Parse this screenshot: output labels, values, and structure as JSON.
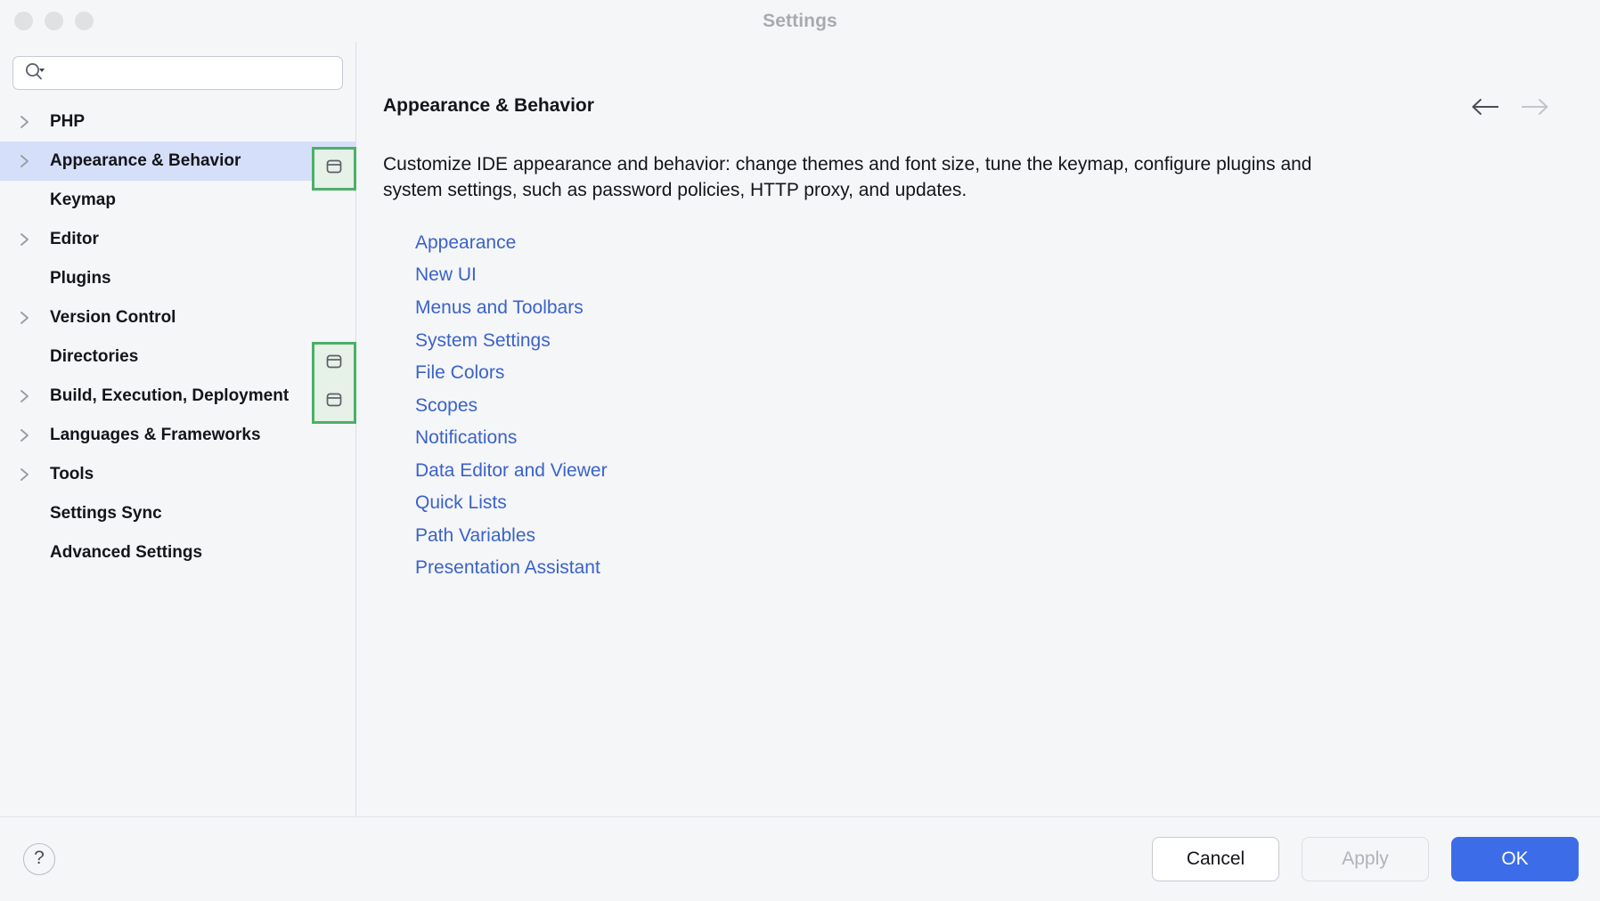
{
  "window": {
    "title": "Settings",
    "traffic_lights": [
      "close-button",
      "minimize-button",
      "maximize-button"
    ]
  },
  "search": {
    "value": "",
    "placeholder": "",
    "icon": "search-icon"
  },
  "sidebar": {
    "items": [
      {
        "label": "PHP",
        "expandable": true,
        "selected": false
      },
      {
        "label": "Appearance & Behavior",
        "expandable": true,
        "selected": true
      },
      {
        "label": "Keymap",
        "expandable": false,
        "selected": false
      },
      {
        "label": "Editor",
        "expandable": true,
        "selected": false
      },
      {
        "label": "Plugins",
        "expandable": false,
        "selected": false
      },
      {
        "label": "Version Control",
        "expandable": true,
        "selected": false
      },
      {
        "label": "Directories",
        "expandable": false,
        "selected": false
      },
      {
        "label": "Build, Execution, Deployment",
        "expandable": true,
        "selected": false
      },
      {
        "label": "Languages & Frameworks",
        "expandable": true,
        "selected": false
      },
      {
        "label": "Tools",
        "expandable": true,
        "selected": false
      },
      {
        "label": "Settings Sync",
        "expandable": false,
        "selected": false
      },
      {
        "label": "Advanced Settings",
        "expandable": false,
        "selected": false
      }
    ]
  },
  "annotations": {
    "border_color": "#4caf68",
    "fill_color": "#e6f1e8",
    "boxes": [
      {
        "name": "annotation-box-1",
        "icons": [
          "panel-icon"
        ]
      },
      {
        "name": "annotation-box-2",
        "icons": [
          "panel-icon",
          "panel-icon"
        ]
      }
    ]
  },
  "main": {
    "title": "Appearance & Behavior",
    "description": "Customize IDE appearance and behavior: change themes and font size, tune the keymap, configure plugins and system settings, such as password policies, HTTP proxy, and updates.",
    "nav": {
      "back": {
        "icon": "arrow-left-icon",
        "enabled": true
      },
      "forward": {
        "icon": "arrow-right-icon",
        "enabled": false
      }
    },
    "links": [
      "Appearance",
      "New UI",
      "Menus and Toolbars",
      "System Settings",
      "File Colors",
      "Scopes",
      "Notifications",
      "Data Editor and Viewer",
      "Quick Lists",
      "Path Variables",
      "Presentation Assistant"
    ],
    "link_color": "#3a62c8"
  },
  "footer": {
    "help_label": "?",
    "cancel_label": "Cancel",
    "apply_label": "Apply",
    "apply_enabled": false,
    "ok_label": "OK",
    "ok_color": "#3c6ce8"
  }
}
